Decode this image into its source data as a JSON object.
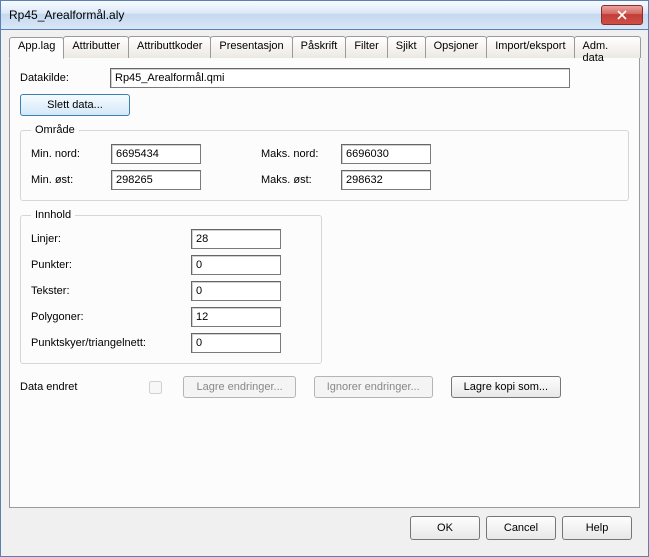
{
  "window": {
    "title": "Rp45_Arealformål.aly"
  },
  "tabs": {
    "app_lag": "App.lag",
    "attributter": "Attributter",
    "attributtkoder": "Attributtkoder",
    "presentasjon": "Presentasjon",
    "paskrift": "Påskrift",
    "filter": "Filter",
    "sjikt": "Sjikt",
    "opsjoner": "Opsjoner",
    "import_eksport": "Import/eksport",
    "adm_data": "Adm. data"
  },
  "labels": {
    "datakilde": "Datakilde:",
    "slett_data": "Slett data...",
    "omrade": "Område",
    "min_nord": "Min. nord:",
    "maks_nord": "Maks. nord:",
    "min_ost": "Min. øst:",
    "maks_ost": "Maks. øst:",
    "innhold": "Innhold",
    "linjer": "Linjer:",
    "punkter": "Punkter:",
    "tekster": "Tekster:",
    "polygoner": "Polygoner:",
    "punktskyer": "Punktskyer/triangelnett:",
    "data_endret": "Data endret",
    "lagre_endringer": "Lagre endringer...",
    "ignorer_endringer": "Ignorer endringer...",
    "lagre_kopi_som": "Lagre kopi som...",
    "ok": "OK",
    "cancel": "Cancel",
    "help": "Help"
  },
  "values": {
    "datakilde": "Rp45_Arealformål.qmi",
    "min_nord": "6695434",
    "maks_nord": "6696030",
    "min_ost": "298265",
    "maks_ost": "298632",
    "linjer": "28",
    "punkter": "0",
    "tekster": "0",
    "polygoner": "12",
    "punktskyer": "0"
  }
}
